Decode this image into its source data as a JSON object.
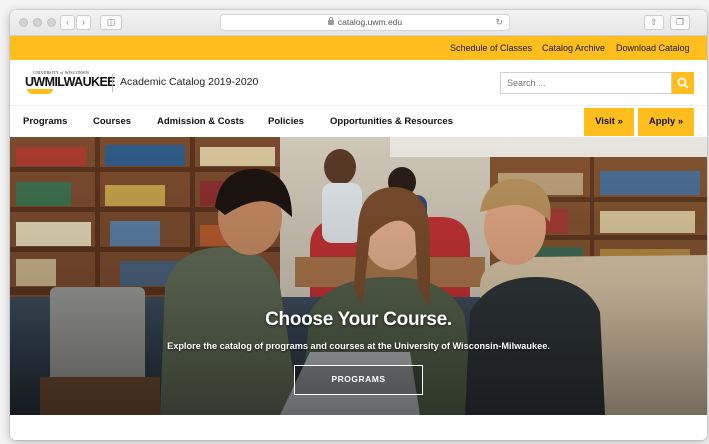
{
  "browser": {
    "url": "catalog.uwm.edu"
  },
  "utility_nav": [
    {
      "label": "Schedule of Classes"
    },
    {
      "label": "Catalog Archive"
    },
    {
      "label": "Download Catalog"
    }
  ],
  "header": {
    "logo_university_line": "UNIVERSITY of WISCONSIN",
    "logo_wordmark": "UWMILWAUKEE",
    "site_title": "Academic Catalog 2019-2020",
    "search_placeholder": "Search ..."
  },
  "main_nav": [
    {
      "label": "Programs"
    },
    {
      "label": "Courses"
    },
    {
      "label": "Admission & Costs"
    },
    {
      "label": "Policies"
    },
    {
      "label": "Opportunities & Resources"
    }
  ],
  "cta": {
    "visit": "Visit »",
    "apply": "Apply »"
  },
  "hero": {
    "title": "Choose Your Course.",
    "subtitle": "Explore the catalog of programs and courses at the University of Wisconsin-Milwaukee.",
    "button": "PROGRAMS"
  },
  "colors": {
    "brand_gold": "#ffbd1e",
    "text_dark": "#111111"
  }
}
